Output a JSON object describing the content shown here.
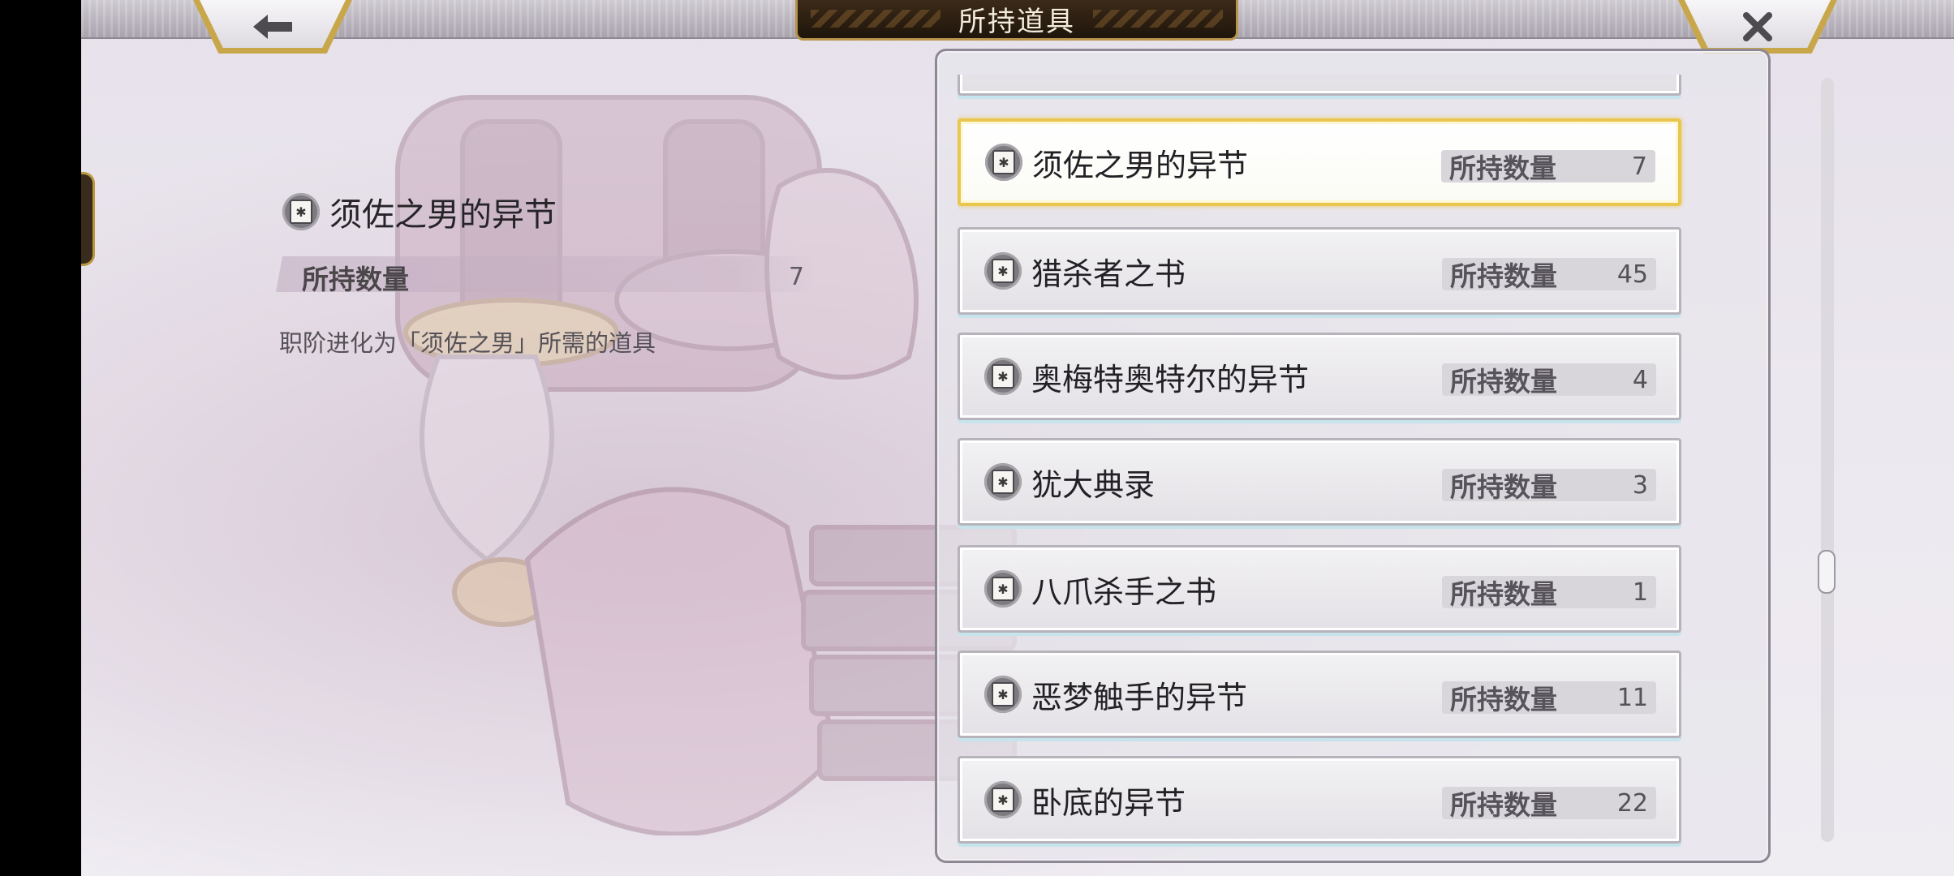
{
  "header": {
    "title": "所持道具",
    "back_icon": "arrow-left-icon",
    "close_icon": "close-x-icon"
  },
  "detail": {
    "name": "须佐之男的异节",
    "qty_label": "所持数量",
    "qty_value": "7",
    "description": "职阶进化为「须佐之男」所需的道具",
    "icon": "book-icon"
  },
  "items": [
    {
      "name": "须佐之男的异节",
      "qty_label": "所持数量",
      "qty": "7",
      "selected": true
    },
    {
      "name": "猎杀者之书",
      "qty_label": "所持数量",
      "qty": "45",
      "selected": false
    },
    {
      "name": "奥梅特奥特尔的异节",
      "qty_label": "所持数量",
      "qty": "4",
      "selected": false
    },
    {
      "name": "犹大典录",
      "qty_label": "所持数量",
      "qty": "3",
      "selected": false
    },
    {
      "name": "八爪杀手之书",
      "qty_label": "所持数量",
      "qty": "1",
      "selected": false
    },
    {
      "name": "恶梦触手的异节",
      "qty_label": "所持数量",
      "qty": "11",
      "selected": false
    },
    {
      "name": "卧底的异节",
      "qty_label": "所持数量",
      "qty": "22",
      "selected": false
    }
  ],
  "colors": {
    "selected_border": "#e9c64d",
    "title_plate": "#2a1d10",
    "accent_gold": "#c8a64a"
  }
}
